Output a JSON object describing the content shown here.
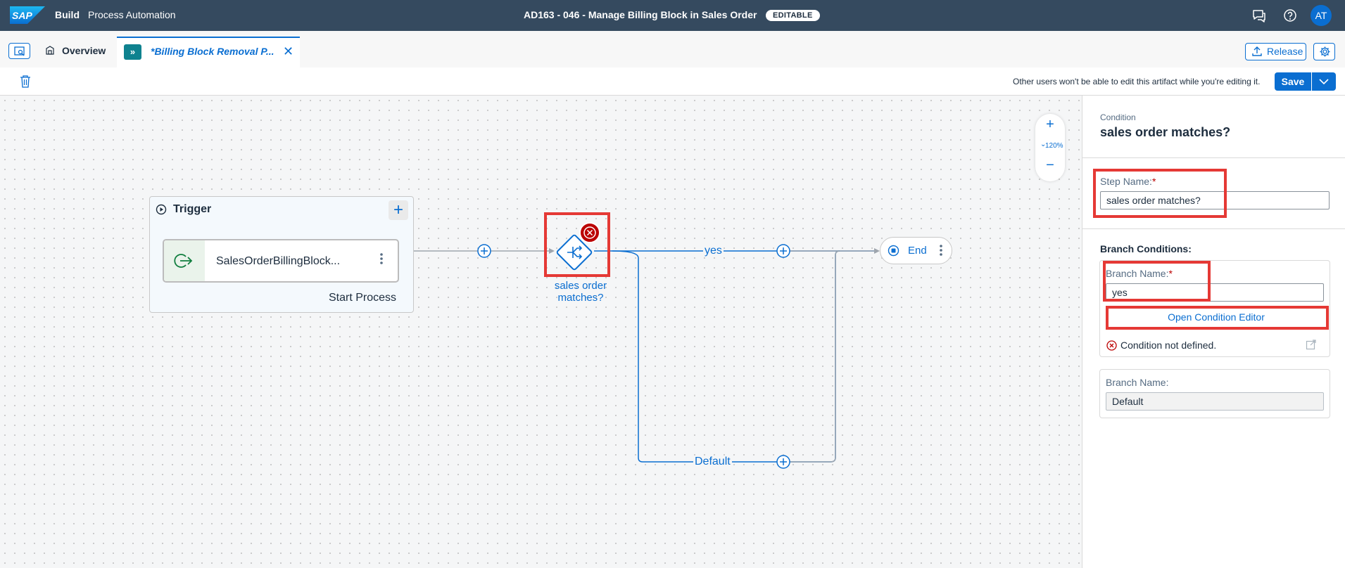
{
  "shell": {
    "logo_text": "SAP",
    "brand": "Build",
    "product": "Process Automation",
    "project_title": "AD163 - 046 - Manage Billing Block in Sales Order",
    "status_badge": "EDITABLE",
    "avatar_initials": "AT",
    "icons": [
      "feedback-icon",
      "help-icon"
    ]
  },
  "tabs": {
    "overview_label": "Overview",
    "active_tab_label": "*Billing Block Removal P...",
    "release_label": "Release"
  },
  "toolbar": {
    "note": "Other users won't be able to edit this artifact while you're editing it.",
    "save_label": "Save"
  },
  "canvas": {
    "zoom_level": "120%",
    "trigger": {
      "title": "Trigger",
      "event_name": "SalesOrderBillingBlock...",
      "footer": "Start Process"
    },
    "condition_node": {
      "label": "sales order matches?"
    },
    "branches": {
      "yes_label": "yes",
      "default_label": "Default"
    },
    "end_node": {
      "label": "End"
    }
  },
  "panel": {
    "type": "Condition",
    "title": "sales order matches?",
    "step_name_label": "Step Name:",
    "step_name_value": "sales order matches?",
    "branch_conditions_label": "Branch Conditions:",
    "branch1": {
      "name_label": "Branch Name:",
      "name_value": "yes",
      "editor_link": "Open Condition Editor",
      "warning": "Condition not defined."
    },
    "branch2": {
      "name_label": "Branch Name:",
      "name_value": "Default"
    }
  },
  "colors": {
    "shell_bg": "#354a5f",
    "accent": "#0a6ed1",
    "error": "#bb0000",
    "highlight": "#e53935"
  }
}
